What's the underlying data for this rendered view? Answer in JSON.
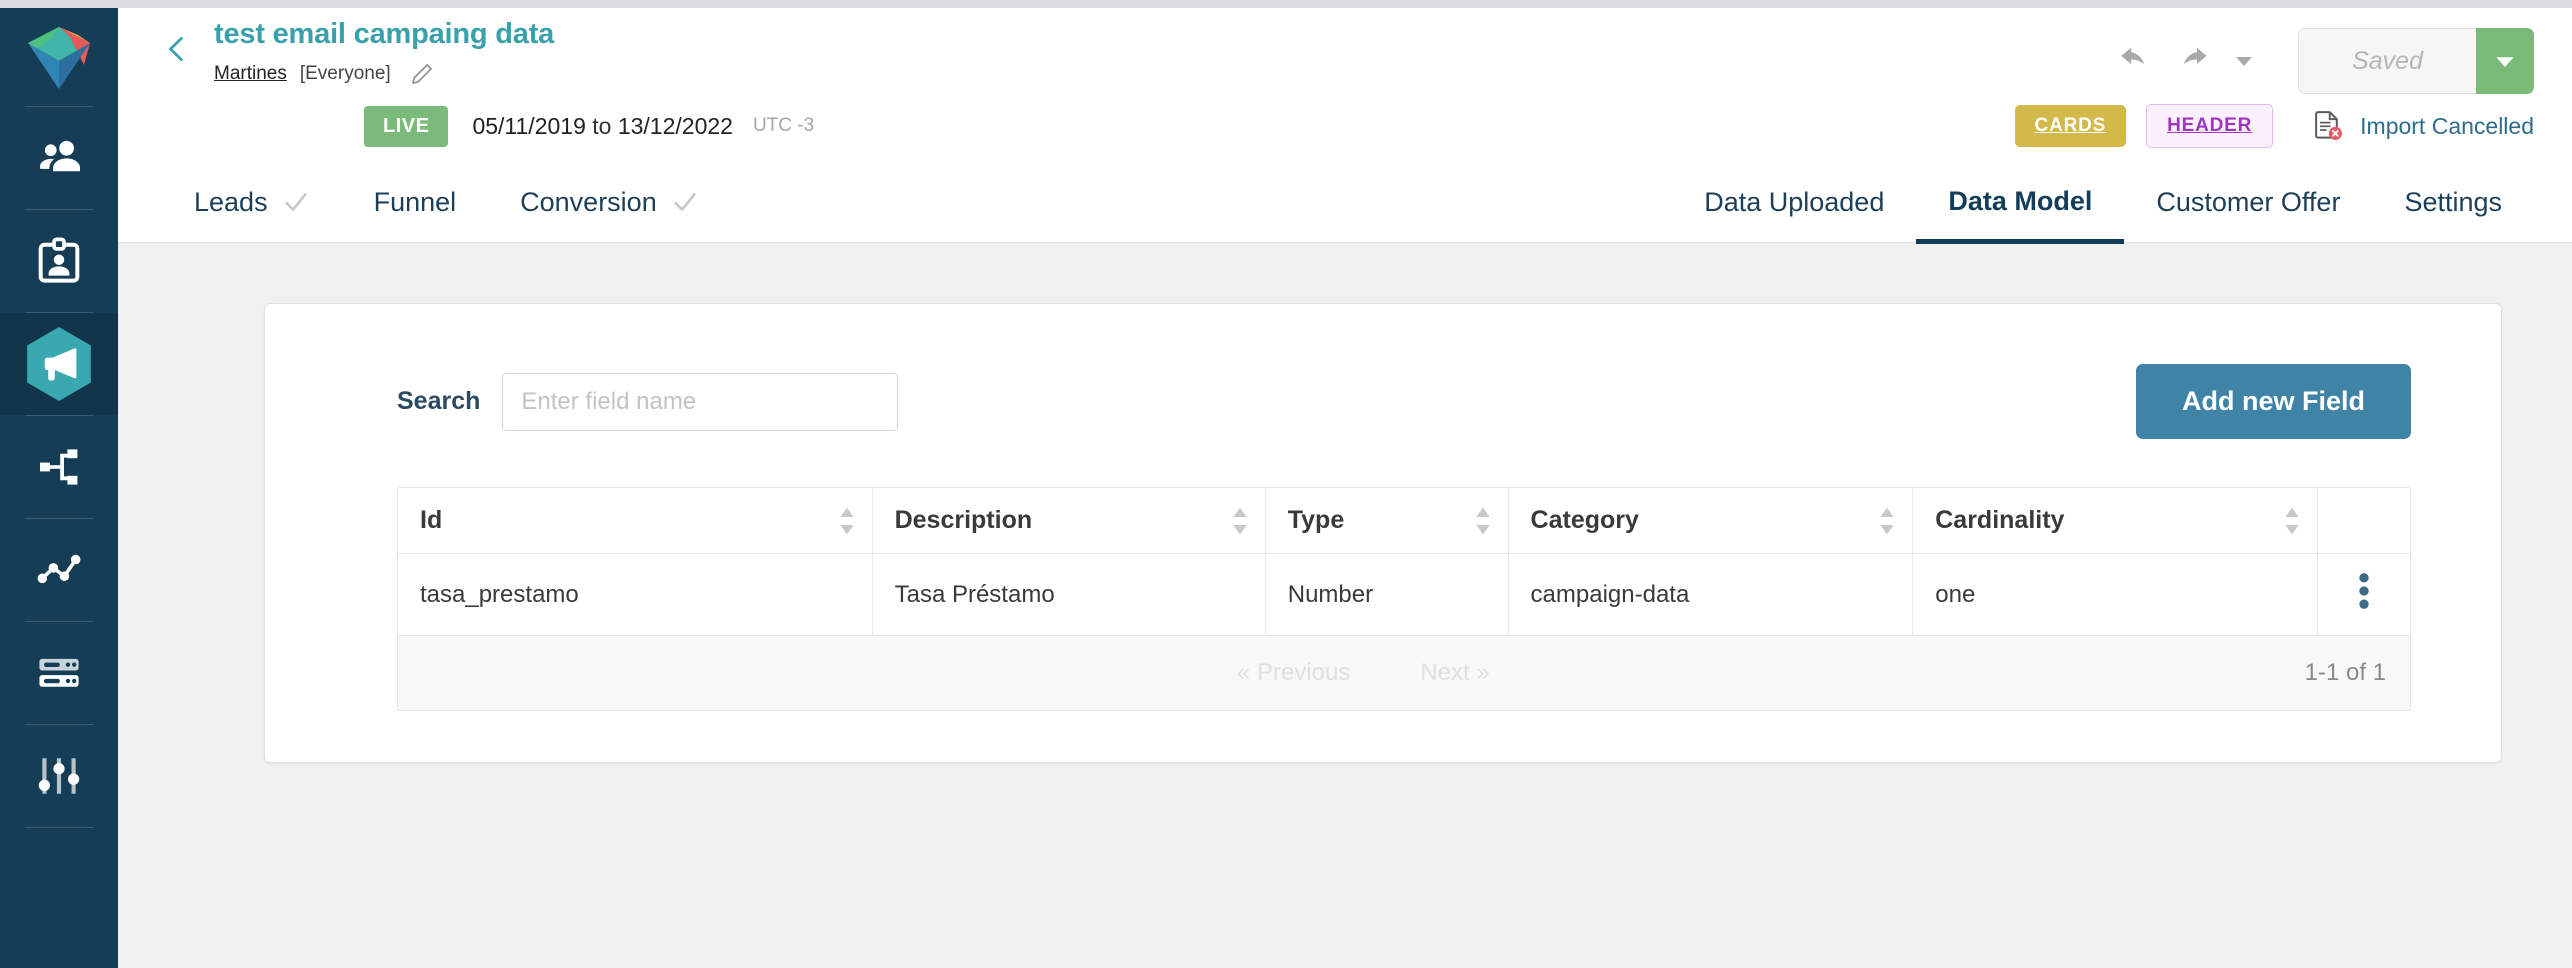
{
  "sidebar": {
    "logo_icon": "prism-logo-icon",
    "items": [
      {
        "icon": "users-icon",
        "name": "sidebar-item-users",
        "active": false
      },
      {
        "icon": "clipboard-user-icon",
        "name": "sidebar-item-leads",
        "active": false
      },
      {
        "icon": "megaphone-icon",
        "name": "sidebar-item-campaigns",
        "active": true
      },
      {
        "icon": "share-nodes-icon",
        "name": "sidebar-item-flows",
        "active": false
      },
      {
        "icon": "line-chart-icon",
        "name": "sidebar-item-analytics",
        "active": false
      },
      {
        "icon": "server-icon",
        "name": "sidebar-item-data",
        "active": false
      },
      {
        "icon": "sliders-icon",
        "name": "sidebar-item-settings",
        "active": false
      }
    ]
  },
  "header": {
    "back_icon": "chevron-left-icon",
    "title": "test email campaing data",
    "owner": "Martines",
    "scope": "[Everyone]",
    "edit_icon": "pencil-icon",
    "undo_icon": "undo-arrow-icon",
    "redo_icon": "redo-arrow-icon",
    "more_caret_icon": "caret-down-icon",
    "saved_label": "Saved",
    "saved_caret_icon": "caret-down-icon",
    "accent_color": "#3aa0ab",
    "save_caret_color": "#79ba78"
  },
  "status": {
    "live_label": "LIVE",
    "live_color": "#7bba7a",
    "date_from": "05/11/2019",
    "date_joiner": "to",
    "date_to": "13/12/2022",
    "timezone": "UTC -3",
    "tag_cards": "CARDS",
    "tag_cards_color": "#d3b94a",
    "tag_header": "HEADER",
    "tag_header_color": "#9f36c0",
    "import_icon": "document-error-icon",
    "import_label": "Import Cancelled",
    "import_label_color": "#2d6d8b"
  },
  "tabs": {
    "left": [
      {
        "label": "Leads",
        "check": true,
        "active": false
      },
      {
        "label": "Funnel",
        "check": false,
        "active": false
      },
      {
        "label": "Conversion",
        "check": true,
        "active": false
      }
    ],
    "right": [
      {
        "label": "Data Uploaded",
        "active": false
      },
      {
        "label": "Data Model",
        "active": true
      },
      {
        "label": "Customer Offer",
        "active": false
      },
      {
        "label": "Settings",
        "active": false
      }
    ]
  },
  "panel": {
    "search_label": "Search",
    "search_value": "",
    "search_placeholder": "Enter field name",
    "add_button": "Add new Field",
    "add_button_color": "#3f83a6"
  },
  "table": {
    "columns": [
      {
        "label": "Id",
        "sortable": true
      },
      {
        "label": "Description",
        "sortable": true
      },
      {
        "label": "Type",
        "sortable": true
      },
      {
        "label": "Category",
        "sortable": true
      },
      {
        "label": "Cardinality",
        "sortable": true
      },
      {
        "label": "",
        "sortable": false
      }
    ],
    "rows": [
      {
        "id": "tasa_prestamo",
        "description": "Tasa Préstamo",
        "type": "Number",
        "category": "campaign-data",
        "cardinality": "one",
        "actions_icon": "kebab-menu-icon"
      }
    ],
    "footer": {
      "previous": "« Previous",
      "next": "Next »",
      "count": "1-1 of 1"
    }
  }
}
